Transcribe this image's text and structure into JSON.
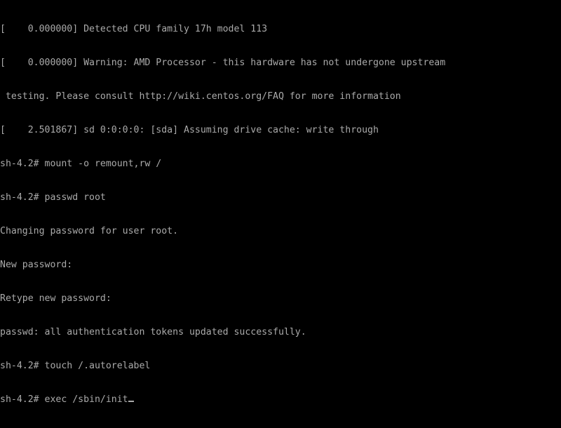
{
  "screen": {
    "title": "CentOS single user mode console",
    "background_color": "#000000",
    "text_color": "#aaaaaa",
    "columns": 100,
    "rows": 37
  },
  "console": {
    "lines": [
      "[    0.000000] Detected CPU family 17h model 113",
      "[    0.000000] Warning: AMD Processor - this hardware has not undergone upstream",
      " testing. Please consult http://wiki.centos.org/FAQ for more information",
      "[    2.501867] sd 0:0:0:0: [sda] Assuming drive cache: write through",
      "sh-4.2# mount -o remount,rw /",
      "sh-4.2# passwd root",
      "Changing password for user root.",
      "New password:",
      "Retype new password:",
      "passwd: all authentication tokens updated successfully.",
      "sh-4.2# touch /.autorelabel"
    ],
    "current_line": "sh-4.2# exec /sbin/init",
    "prompt": "sh-4.2#",
    "cursor": "_"
  }
}
